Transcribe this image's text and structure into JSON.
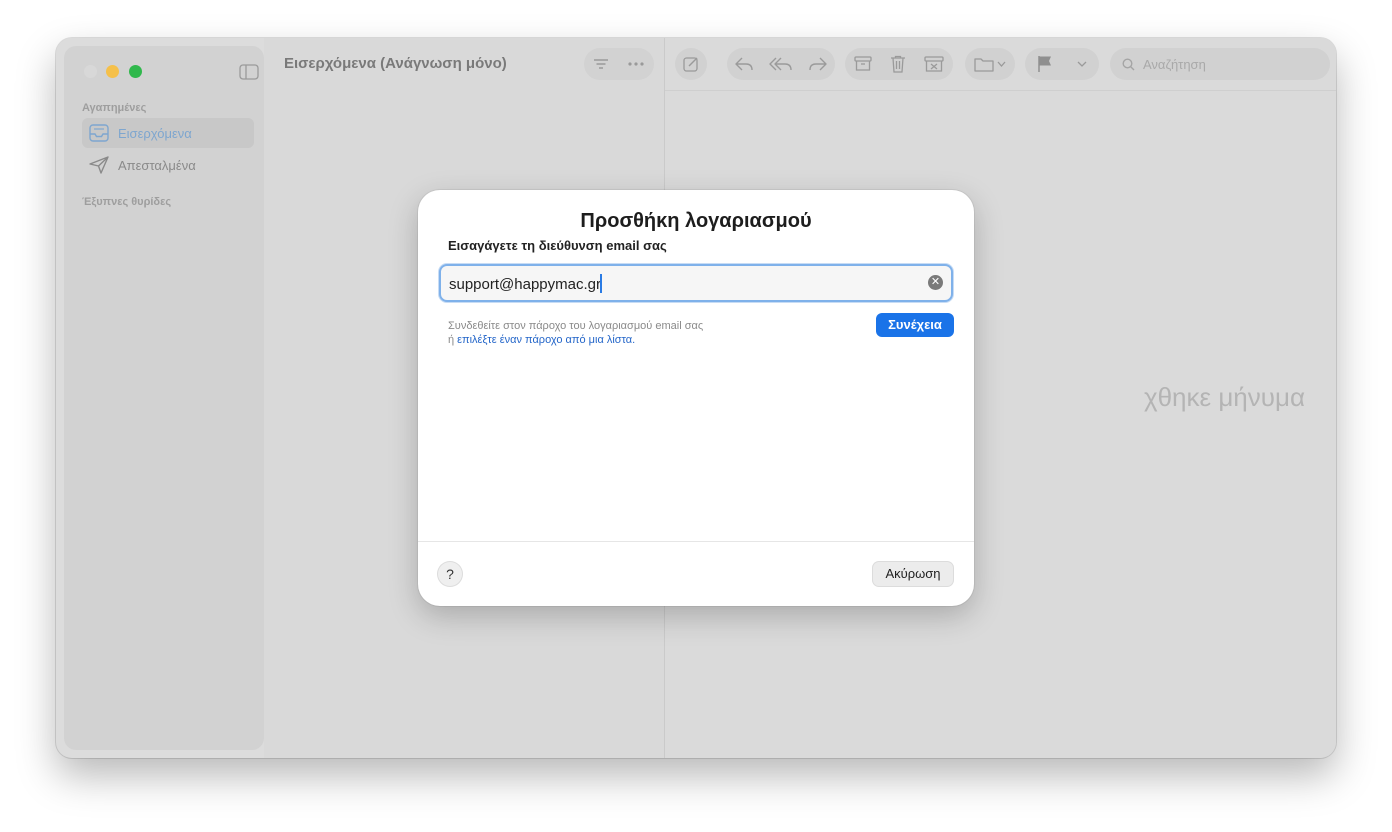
{
  "window": {
    "list_title": "Εισερχόμενα (Ανάγνωση μόνο)",
    "empty_message": "χθηκε μήνυμα"
  },
  "sidebar": {
    "favorites_label": "Αγαπημένες",
    "items": [
      {
        "label": "Εισερχόμενα",
        "icon": "inbox-icon",
        "selected": true
      },
      {
        "label": "Απεσταλμένα",
        "icon": "paper-plane-icon",
        "selected": false
      }
    ],
    "smart_mailboxes_label": "Έξυπνες θυρίδες"
  },
  "toolbar": {
    "search_placeholder": "Αναζήτηση"
  },
  "dialog": {
    "title": "Προσθήκη λογαριασμού",
    "subtitle": "Εισαγάγετε τη διεύθυνση email σας",
    "email_value": "support@happymac.gr",
    "help_text_line1": "Συνδεθείτε στον πάροχο του λογαριασμού email σας",
    "help_text_or": "ή",
    "help_link": "επιλέξτε έναν πάροχο από μια λίστα.",
    "continue_label": "Συνέχεια",
    "help_button_label": "?",
    "cancel_label": "Ακύρωση"
  },
  "colors": {
    "accent": "#1a73e8",
    "link": "#2466c9",
    "traffic_min": "#f5c04a",
    "traffic_max": "#30b84c"
  }
}
